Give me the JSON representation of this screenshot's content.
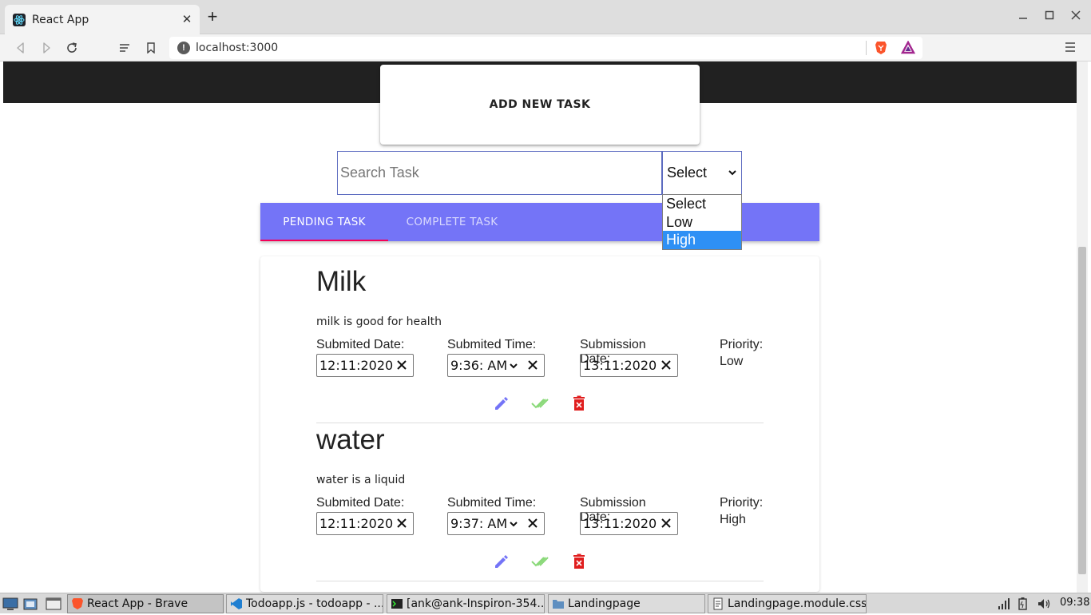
{
  "browser": {
    "tab_title": "React App",
    "url": "localhost:3000",
    "new_tab": "+",
    "tab_close": "✕"
  },
  "app": {
    "add_task_label": "ADD NEW TASK",
    "search_placeholder": "Search Task",
    "priority_select": {
      "selected": "Select",
      "options": [
        "Select",
        "Low",
        "High"
      ],
      "highlighted": "High"
    },
    "tabs": [
      {
        "label": "PENDING TASK",
        "active": true
      },
      {
        "label": "COMPLETE TASK",
        "active": false
      }
    ],
    "field_labels": {
      "submitted_date": "Submited Date:",
      "submitted_time": "Submited Time:",
      "submission_date": "Submission Date:",
      "priority": "Priority:"
    },
    "tasks": [
      {
        "title": "Milk",
        "description": "milk is good for health",
        "submitted_date": "12:11:2020",
        "submitted_time": "9:36: AM",
        "submission_date": "13:11:2020",
        "priority": "Low"
      },
      {
        "title": "water",
        "description": "water is a liquid",
        "submitted_date": "12:11:2020",
        "submitted_time": "9:37: AM",
        "submission_date": "13:11:2020",
        "priority": "High"
      }
    ],
    "colors": {
      "tab_bar": "#7474f7",
      "tab_indicator": "#f50057",
      "edit_icon": "#7474f7",
      "complete_icon": "#8bd97a",
      "delete_icon": "#e01e1e"
    }
  },
  "taskbar": {
    "windows": [
      {
        "label": "React App - Brave",
        "active": true
      },
      {
        "label": "Todoapp.js - todoapp - ...",
        "active": false
      },
      {
        "label": "[ank@ank-Inspiron-354...",
        "active": false
      },
      {
        "label": "Landingpage",
        "active": false
      },
      {
        "label": "Landingpage.module.css",
        "active": false
      }
    ],
    "clock": "09:38"
  }
}
